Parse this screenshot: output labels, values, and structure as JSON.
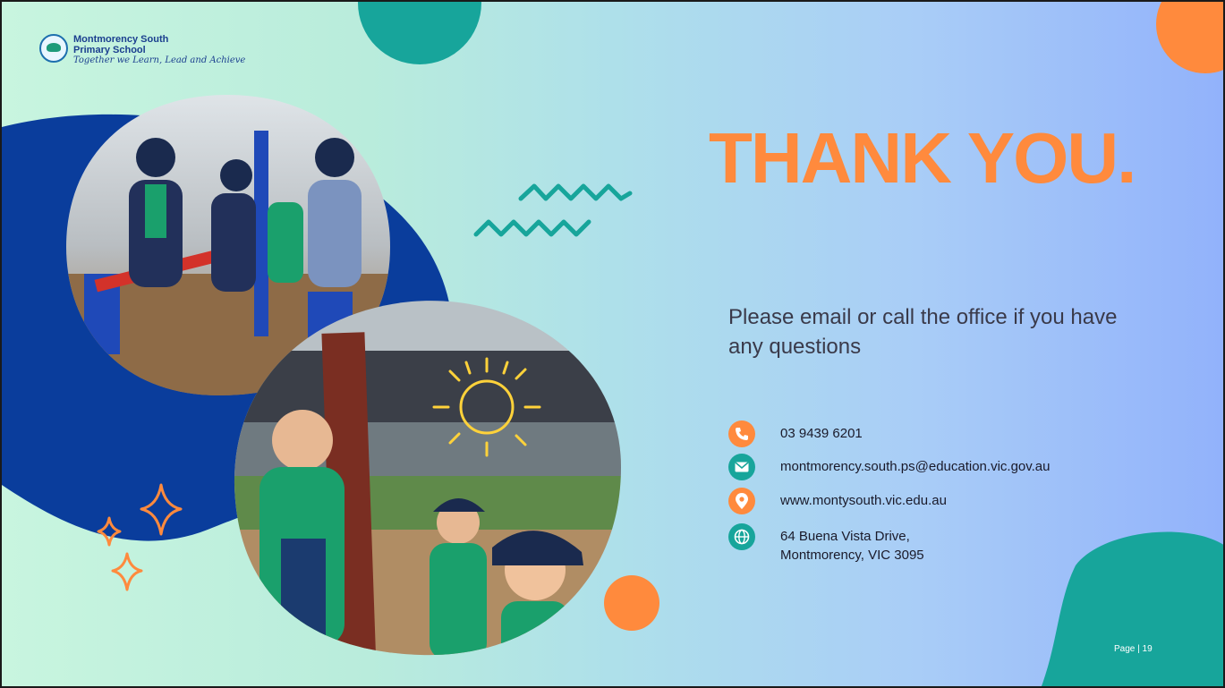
{
  "school": {
    "name_line1": "Montmorency South",
    "name_line2": "Primary School",
    "tagline": "Together we Learn, Lead and Achieve"
  },
  "slide": {
    "title": "THANK YOU.",
    "subtitle": "Please email or call the office if you have any questions",
    "page_label": "Page | 19"
  },
  "contacts": [
    {
      "icon": "phone-icon",
      "lines": [
        "03 9439 6201"
      ]
    },
    {
      "icon": "email-icon",
      "lines": [
        "montmorency.south.ps@education.vic.gov.au"
      ]
    },
    {
      "icon": "location-pin-icon",
      "lines": [
        "www.montysouth.vic.edu.au"
      ]
    },
    {
      "icon": "globe-icon",
      "lines": [
        "64 Buena Vista Drive,",
        "Montmorency, VIC 3095"
      ]
    }
  ],
  "colors": {
    "orange": "#ff8a3d",
    "teal": "#17a59b",
    "navy": "#0a3d9c",
    "title_orange": "#ff8a3d"
  }
}
